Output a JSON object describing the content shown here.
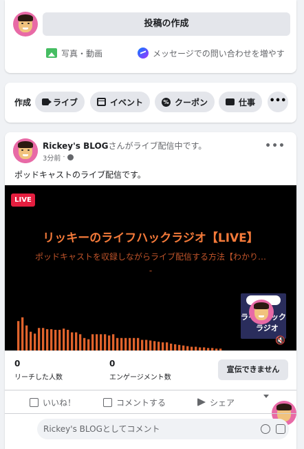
{
  "composer": {
    "post_button": "投稿の作成",
    "photo_label": "写真・動画",
    "messenger_label": "メッセージでの問い合わせを増やす",
    "icons": [
      "photo-icon",
      "messenger-icon"
    ]
  },
  "create_bar": {
    "label": "作成",
    "chips": [
      {
        "label": "ライブ",
        "icon": "video-camera-icon"
      },
      {
        "label": "イベント",
        "icon": "calendar-icon"
      },
      {
        "label": "クーポン",
        "icon": "coupon-icon"
      },
      {
        "label": "仕事",
        "icon": "briefcase-icon"
      }
    ],
    "more": "•••"
  },
  "post": {
    "author": "Rickey's BLOG",
    "action_text": "さんがライブ配信中です。",
    "time": "3分前",
    "privacy_icon": "globe-icon",
    "more": "•••",
    "text": "ポッドキャストのライブ配信です。",
    "video": {
      "badge": "LIVE",
      "title": "リッキーのライフハックラジオ【LIVE】",
      "subtitle_line1": "ポッドキャストを収録しながらライブ配信する方法【わかり…",
      "subtitle_line2": "-",
      "thumb_line1": "ライフハック",
      "thumb_line2": "ラジオ",
      "mute_icon": "🔇",
      "eq_levels": [
        0.47,
        0.53,
        0.4,
        0.3,
        0.27,
        0.36,
        0.36,
        0.34,
        0.34,
        0.33,
        0.33,
        0.35,
        0.33,
        0.29,
        0.29,
        0.26,
        0.2,
        0.18,
        0.26,
        0.26,
        0.26,
        0.26,
        0.24,
        0.26,
        0.2,
        0.2,
        0.2,
        0.2,
        0.2,
        0.2,
        0.17,
        0.17,
        0.16,
        0.15,
        0.14,
        0.13,
        0.13,
        0.11,
        0.1,
        0.09,
        0.08,
        0.07,
        0.06,
        0.06,
        0.05,
        0.05,
        0.04,
        0.04,
        0.03,
        0.03
      ],
      "eq_color": "#e0632c"
    },
    "stats": {
      "reach_value": "0",
      "reach_label": "リーチした人数",
      "engagement_value": "0",
      "engagement_label": "エンゲージメント数",
      "promote_button": "宣伝できません"
    },
    "actions": {
      "like": "いいね！",
      "comment": "コメントする",
      "share": "シェア"
    },
    "comment_placeholder": "Rickey's BLOGとしてコメント"
  },
  "colors": {
    "accent": "#1877f2",
    "live_red": "#e41e3f",
    "title_orange": "#f47a3a",
    "background": "#f0f2f5"
  }
}
